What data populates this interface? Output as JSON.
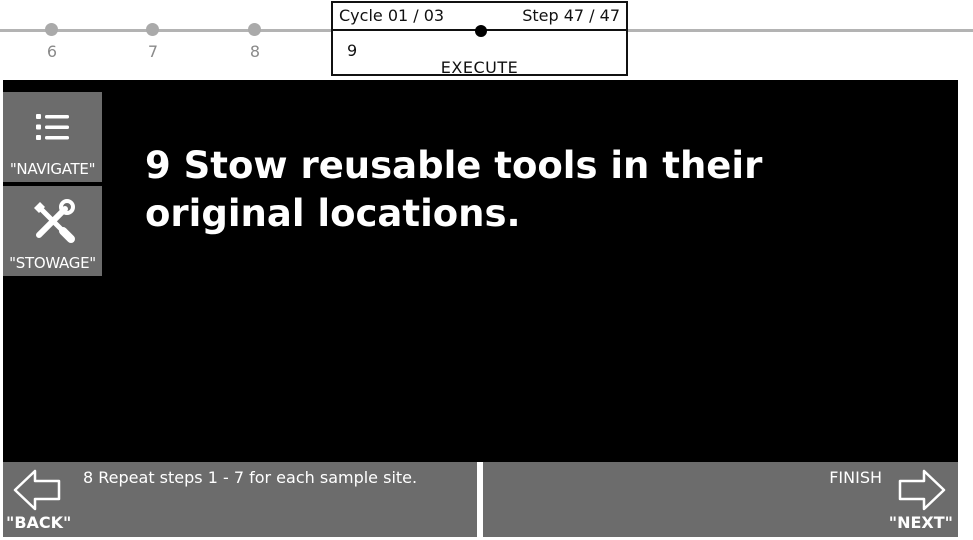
{
  "timeline": {
    "ticks": [
      "6",
      "7",
      "8"
    ],
    "cycle": "Cycle 01 / 03",
    "step": "Step 47 / 47",
    "current_step": "9",
    "phase": "EXECUTE"
  },
  "sidebar": {
    "navigate_label": "\"NAVIGATE\"",
    "stowage_label": "\"STOWAGE\""
  },
  "main": {
    "instruction": "9 Stow reusable tools in their original locations."
  },
  "footer": {
    "back_label": "\"BACK\"",
    "previous_step": "8 Repeat steps 1 - 7 for each sample site.",
    "next_label": "\"NEXT\"",
    "next_step": "FINISH"
  },
  "colors": {
    "panel_gray": "#6c6c6c",
    "main_background": "#000000",
    "timeline_gray": "#b3b3b3"
  },
  "icons": [
    "list-icon",
    "tools-icon",
    "back-arrow-icon",
    "next-arrow-icon"
  ]
}
